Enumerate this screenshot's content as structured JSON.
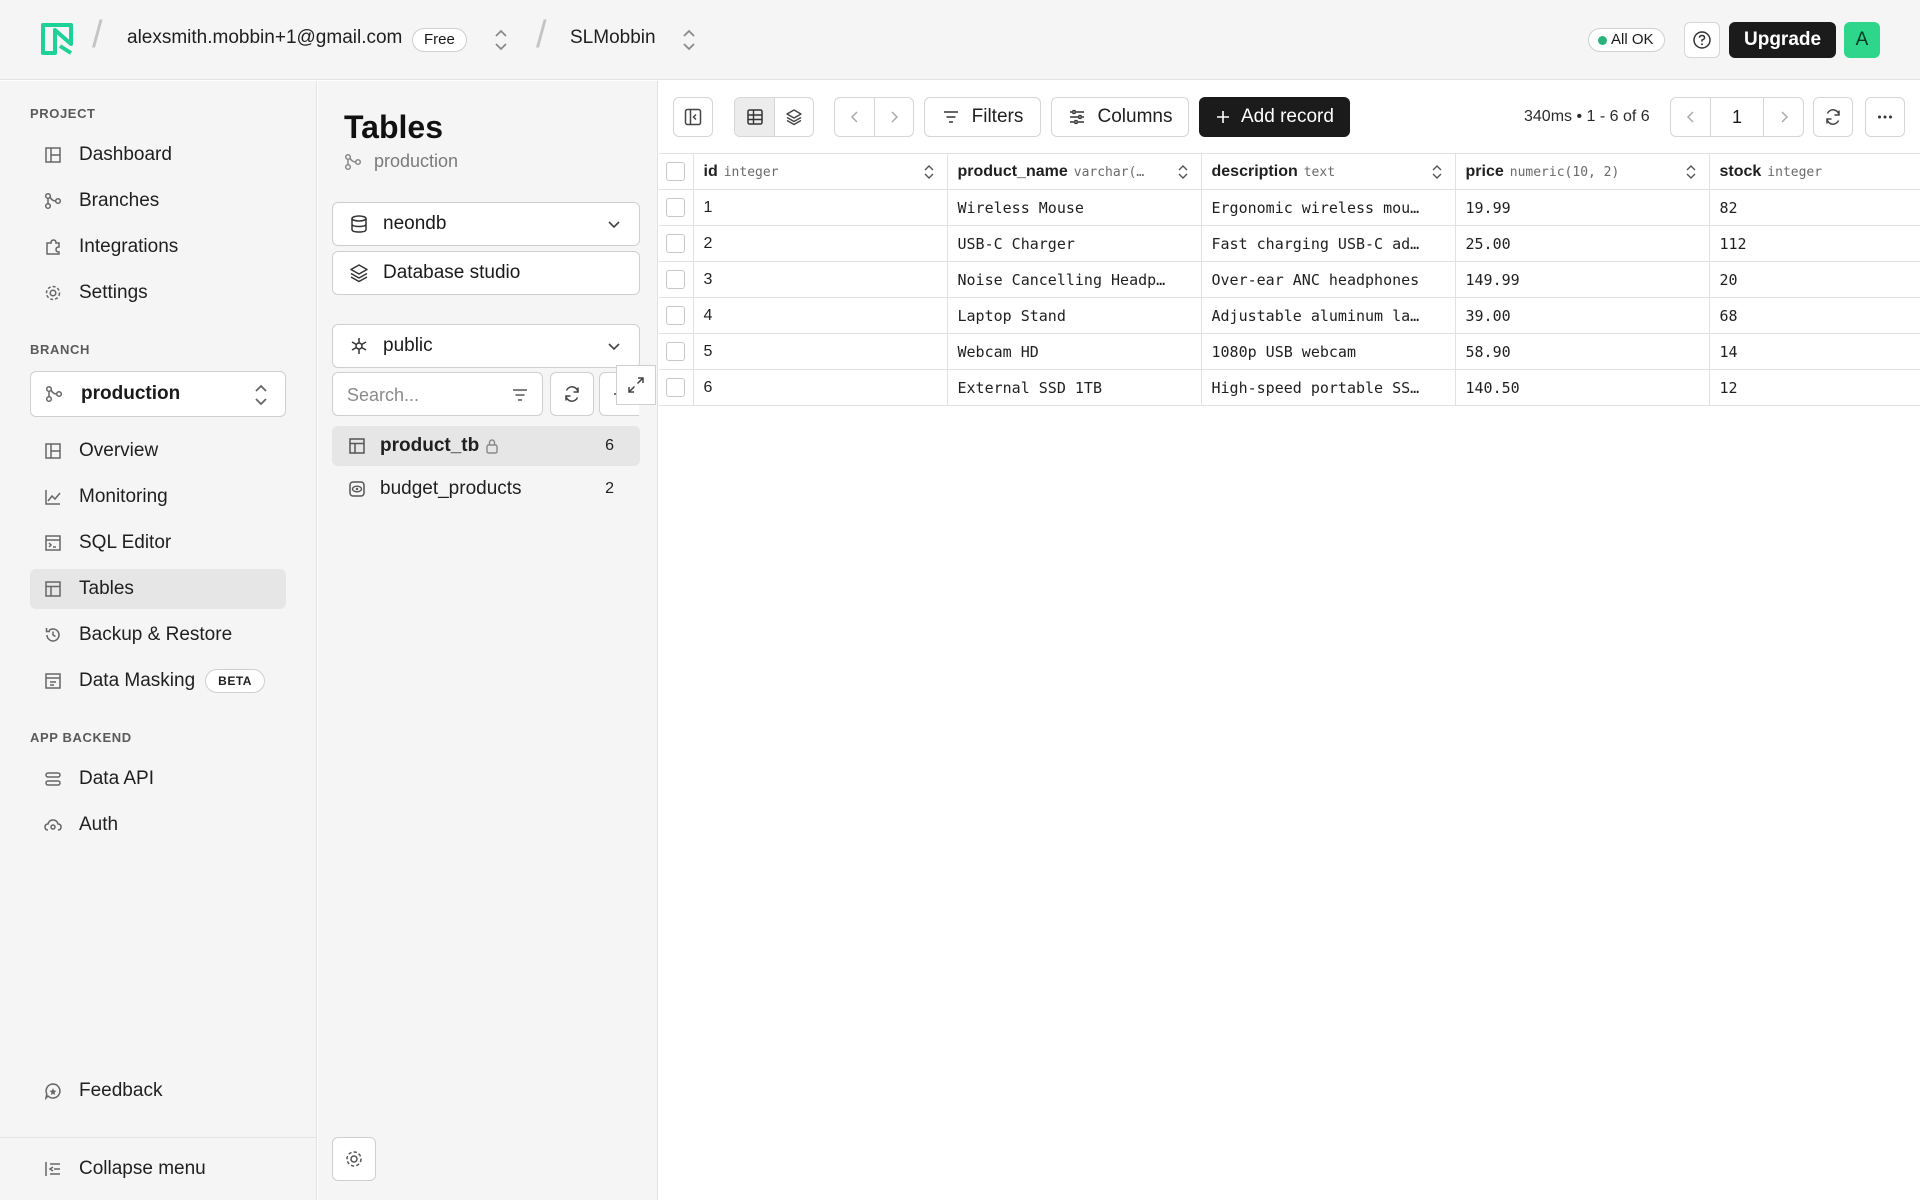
{
  "header": {
    "account": "alexsmith.mobbin+1@gmail.com",
    "plan": "Free",
    "project": "SLMobbin",
    "status": "All OK",
    "upgrade_label": "Upgrade",
    "avatar_letter": "A",
    "colors": {
      "avatar": "#2ed68b",
      "status_dot": "#2ab27b",
      "logo": "#1fd196"
    }
  },
  "sidebar": {
    "project_label": "PROJECT",
    "project_items": [
      "Dashboard",
      "Branches",
      "Integrations",
      "Settings"
    ],
    "branch_label": "BRANCH",
    "branch_value": "production",
    "branch_items": [
      "Overview",
      "Monitoring",
      "SQL Editor",
      "Tables",
      "Backup & Restore",
      "Data Masking"
    ],
    "beta_badge": "BETA",
    "backend_label": "APP BACKEND",
    "backend_items": [
      "Data API",
      "Auth"
    ],
    "feedback": "Feedback",
    "collapse": "Collapse menu"
  },
  "tables_panel": {
    "title": "Tables",
    "branch": "production",
    "database": "neondb",
    "studio": "Database studio",
    "schema": "public",
    "search_placeholder": "Search...",
    "tables": [
      {
        "name": "product_tb",
        "count": "6"
      },
      {
        "name": "budget_products",
        "count": "2"
      }
    ]
  },
  "toolbar": {
    "filters": "Filters",
    "columns": "Columns",
    "add_record": "Add record",
    "stats": "340ms • 1 - 6 of 6",
    "page": "1"
  },
  "grid": {
    "columns": [
      {
        "name": "id",
        "type": "integer"
      },
      {
        "name": "product_name",
        "type": "varchar(…"
      },
      {
        "name": "description",
        "type": "text"
      },
      {
        "name": "price",
        "type": "numeric(10, 2)"
      },
      {
        "name": "stock",
        "type": "integer"
      }
    ],
    "rows": [
      [
        "1",
        "Wireless Mouse",
        "Ergonomic wireless mou…",
        "19.99",
        "82"
      ],
      [
        "2",
        "USB-C Charger",
        "Fast charging USB-C ad…",
        "25.00",
        "112"
      ],
      [
        "3",
        "Noise Cancelling Headp…",
        "Over-ear ANC headphones",
        "149.99",
        "20"
      ],
      [
        "4",
        "Laptop Stand",
        "Adjustable aluminum la…",
        "39.00",
        "68"
      ],
      [
        "5",
        "Webcam HD",
        "1080p USB webcam",
        "58.90",
        "14"
      ],
      [
        "6",
        "External SSD 1TB",
        "High-speed portable SS…",
        "140.50",
        "12"
      ]
    ]
  }
}
